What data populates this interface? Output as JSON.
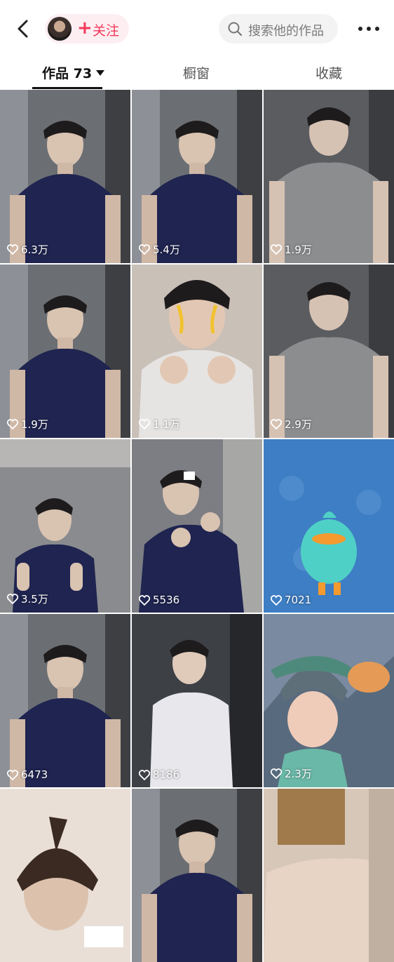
{
  "header": {
    "follow_label": "关注",
    "follow_plus": "+",
    "search_placeholder": "搜索他的作品"
  },
  "tabs": [
    {
      "label": "作品 73"
    },
    {
      "label": "橱窗"
    },
    {
      "label": "收藏"
    }
  ],
  "colors": {
    "accent": "#f3395b",
    "follow_bg": "#fdeef1",
    "search_bg": "#f3f3f3"
  },
  "videos": [
    {
      "likes": "6.3万",
      "scene": "navy-shirt"
    },
    {
      "likes": "5.4万",
      "scene": "navy-shirt"
    },
    {
      "likes": "1.9万",
      "scene": "gray-shirt"
    },
    {
      "likes": "1.9万",
      "scene": "navy-shirt"
    },
    {
      "likes": "1.1万",
      "scene": "white-shirt-fists"
    },
    {
      "likes": "2.9万",
      "scene": "gray-shirt"
    },
    {
      "likes": "3.5万",
      "scene": "navy-shirt-pointing"
    },
    {
      "likes": "5536",
      "scene": "navy-shirt-fists"
    },
    {
      "likes": "7021",
      "scene": "game-bird"
    },
    {
      "likes": "6473",
      "scene": "navy-shirt"
    },
    {
      "likes": "8186",
      "scene": "white-shirt"
    },
    {
      "likes": "2.3万",
      "scene": "game-character"
    },
    {
      "likes": "",
      "scene": "face-filter"
    },
    {
      "likes": "",
      "scene": "navy-shirt"
    },
    {
      "likes": "",
      "scene": "box-head"
    }
  ]
}
